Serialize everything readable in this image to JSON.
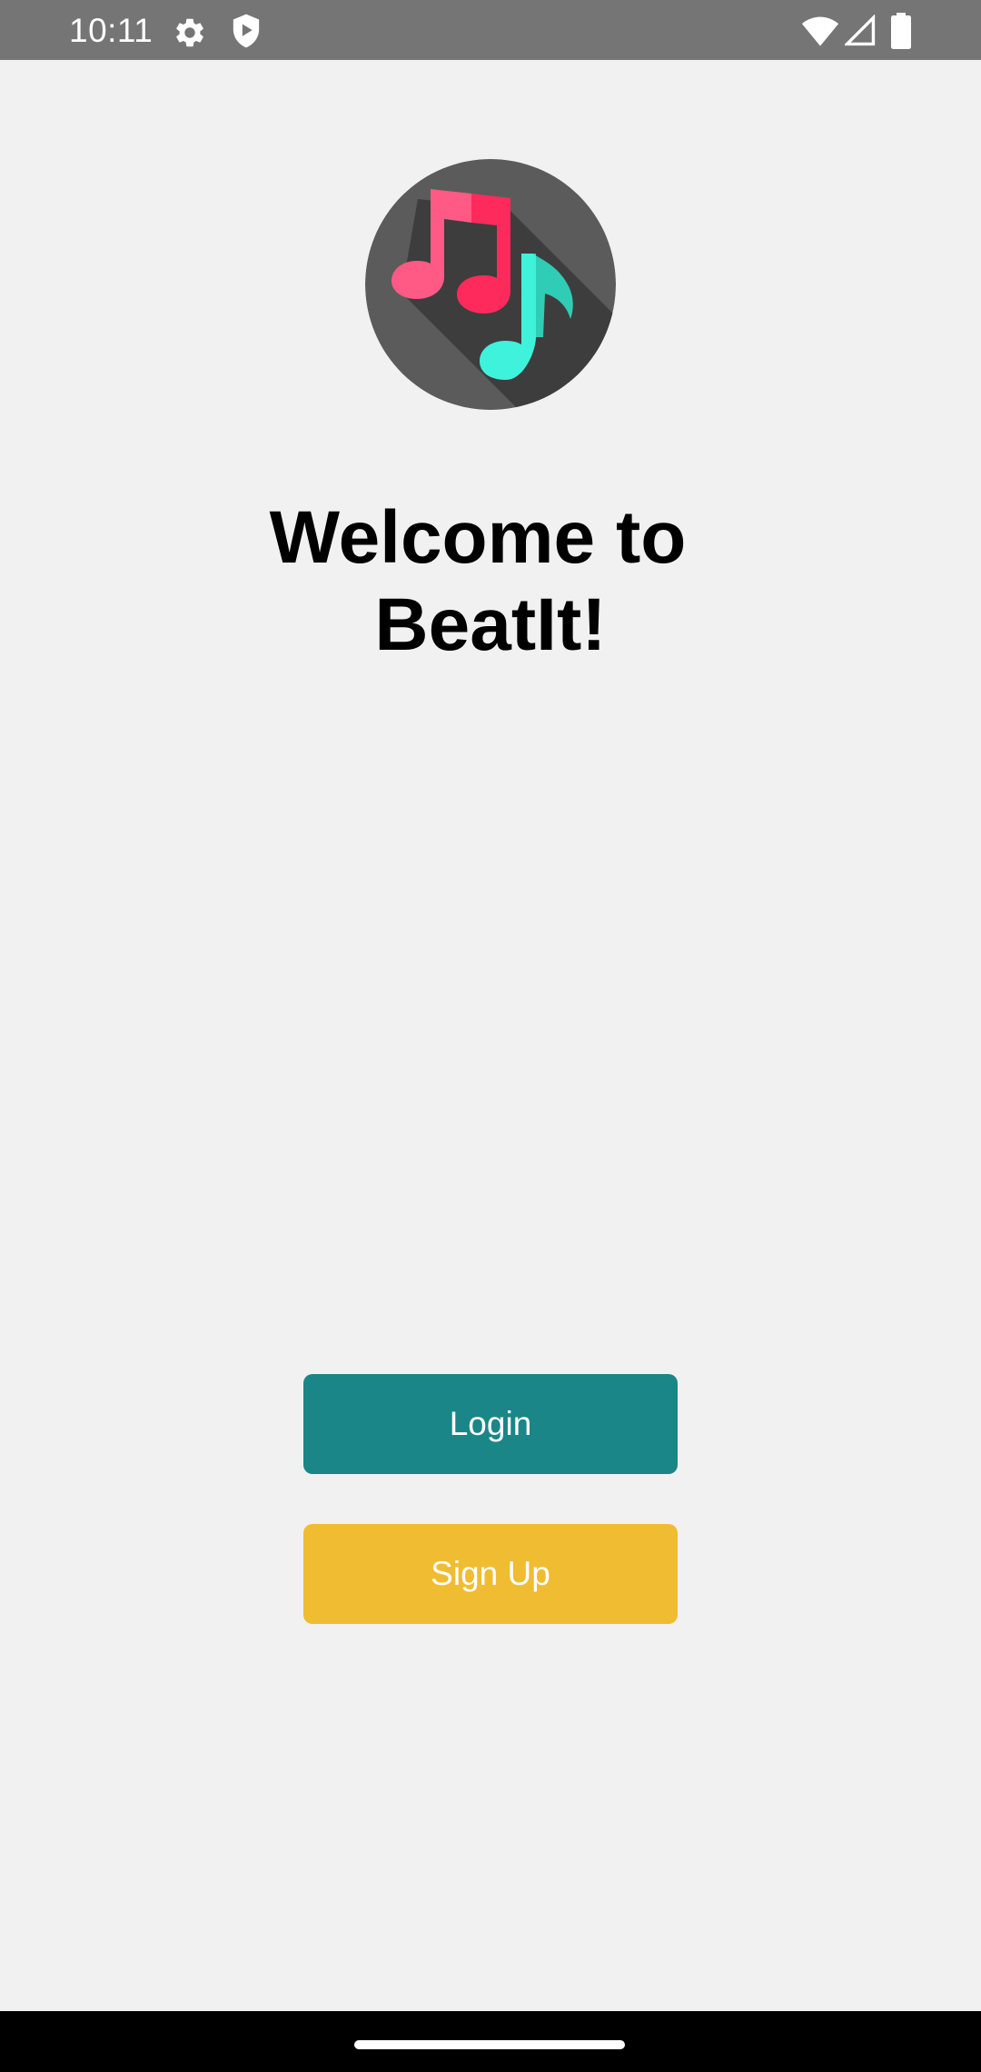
{
  "status_bar": {
    "time": "10:11",
    "icons": [
      "gear-icon",
      "shield-icon",
      "wifi-icon",
      "signal-icon",
      "battery-icon"
    ]
  },
  "logo": {
    "icon": "music-notes-icon",
    "colors": {
      "background": "#5b5b5b",
      "shadow": "#3d3d3d",
      "note_pink": "#ff5a85",
      "note_pink_dark": "#ff2a5c",
      "note_teal": "#3ff2dc",
      "note_teal_dark": "#2fcdb5"
    }
  },
  "welcome": {
    "line1": "Welcome to",
    "line2": "BeatIt!"
  },
  "buttons": {
    "login_label": "Login",
    "signup_label": "Sign Up"
  },
  "colors": {
    "background": "#f1f1f1",
    "status_bar": "#757575",
    "login": "#1a8688",
    "signup": "#f0bc31",
    "nav_bar": "#000000"
  }
}
